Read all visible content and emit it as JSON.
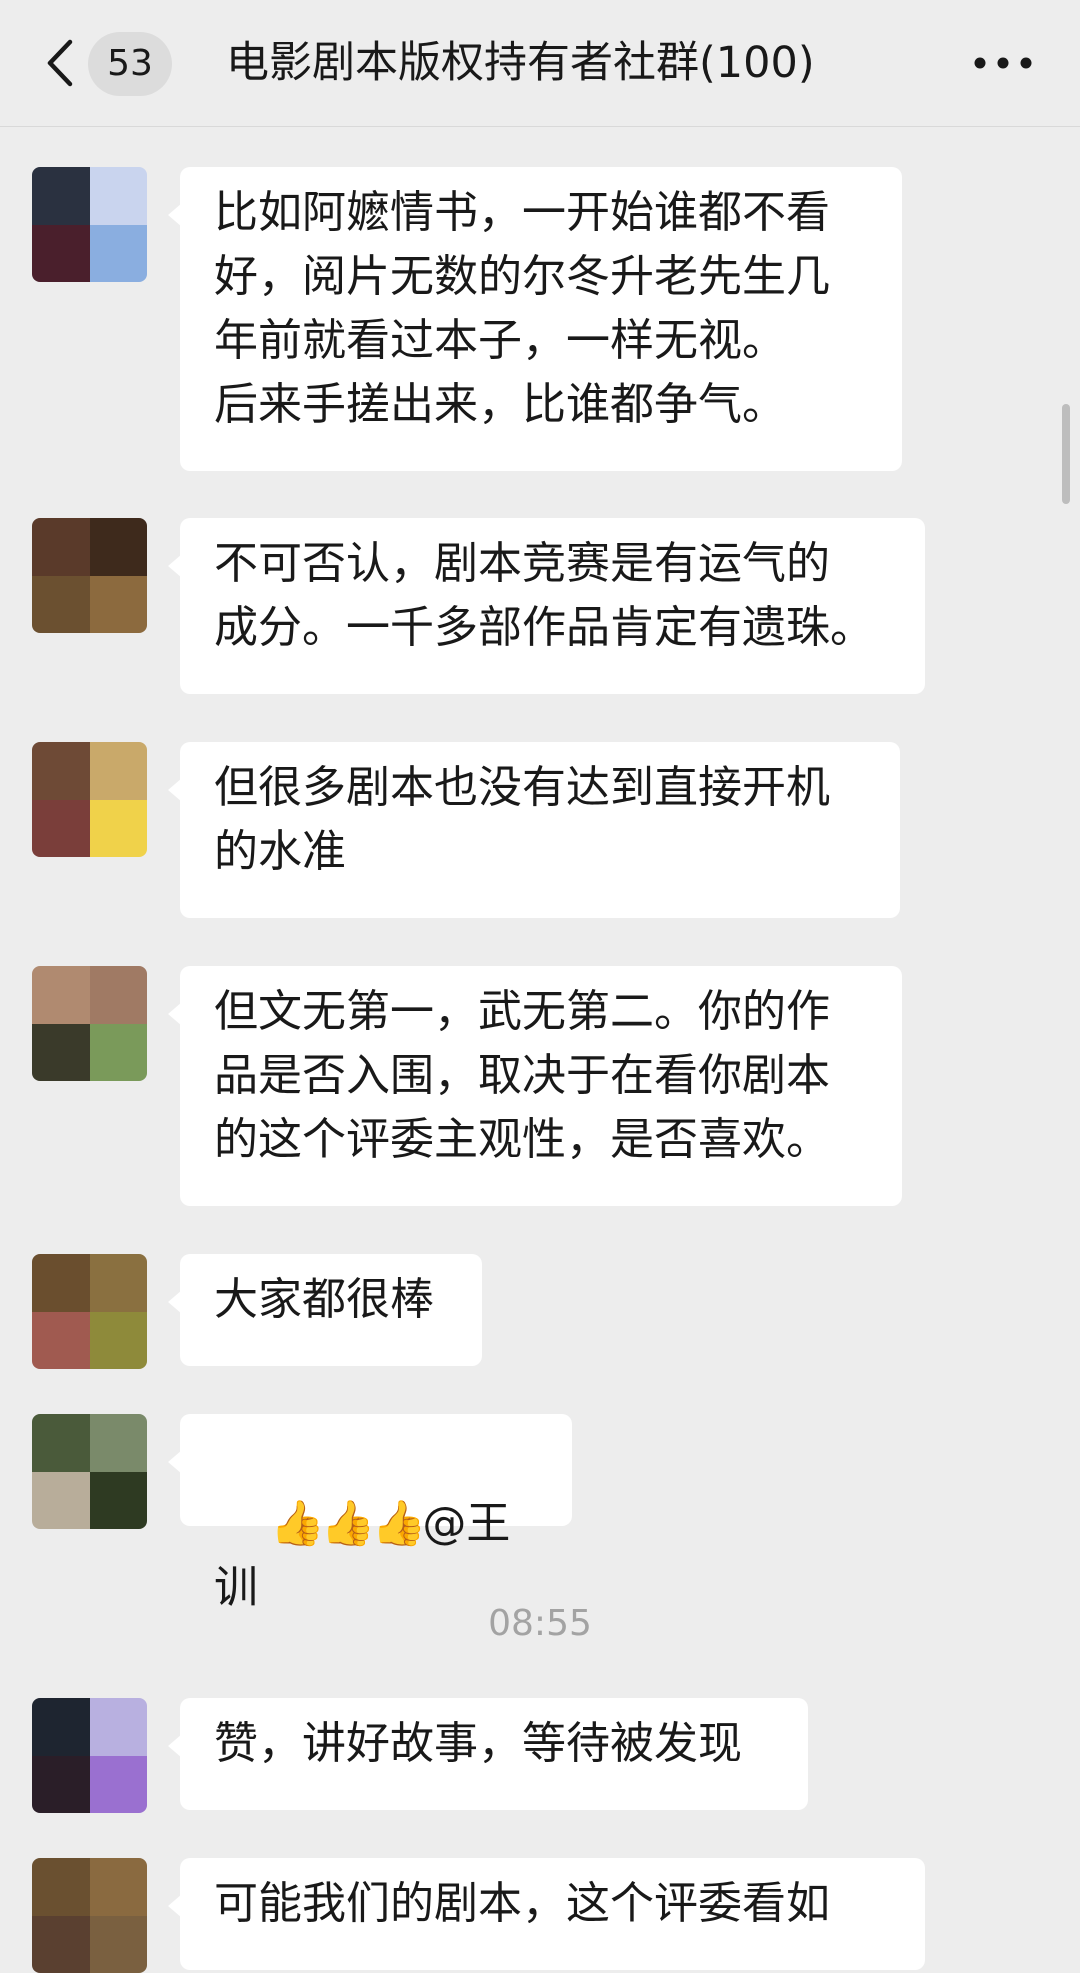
{
  "header": {
    "unread_count": "53",
    "title": "电影剧本版权持有者社群(100)"
  },
  "messages": [
    {
      "text": "比如阿嬷情书，一开始谁都不看\n好，阅片无数的尔冬升老先生几\n年前就看过本子，一样无视。\n后来手搓出来，比谁都争气。"
    },
    {
      "text": "不可否认，剧本竞赛是有运气的\n成分。一千多部作品肯定有遗珠。"
    },
    {
      "text": "但很多剧本也没有达到直接开机\n的水准"
    },
    {
      "text": "但文无第一，武无第二。你的作\n品是否入围，取决于在看你剧本\n的这个评委主观性，是否喜欢。"
    },
    {
      "text": "大家都很棒"
    },
    {
      "text": "@王训",
      "emoji_icons": [
        "thumbs-up-icon",
        "thumbs-up-icon",
        "thumbs-up-icon"
      ]
    },
    {
      "text": "赞，讲好故事，等待被发现"
    },
    {
      "text": "可能我们的剧本，这个评委看如"
    }
  ],
  "timestamp": "08:55",
  "colors": {
    "background": "#ededed",
    "bubble": "#ffffff",
    "text": "#191919",
    "badge": "#dcdcdc",
    "timestamp": "#a3a3a3"
  }
}
